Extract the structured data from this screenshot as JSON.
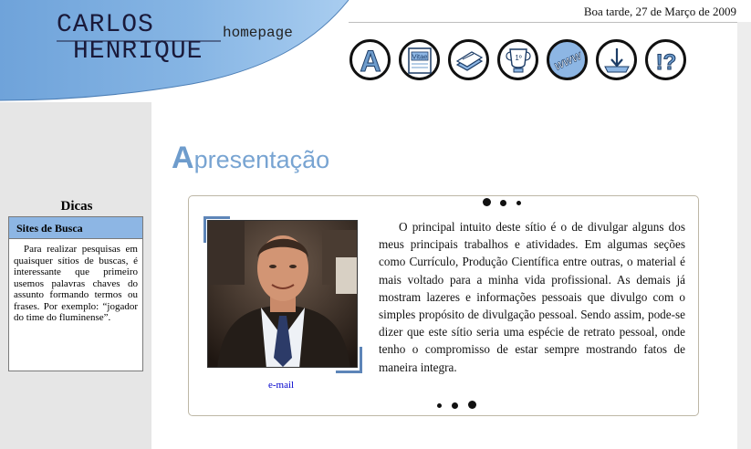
{
  "header": {
    "name_line1": "CARLOS",
    "name_line2": "HENRIQUE",
    "subtitle": "homepage",
    "date_text": "Boa tarde, 27 de Março de 2009",
    "swoosh_color": "#7eaee0"
  },
  "nav": [
    {
      "icon": "letter-a-icon",
      "glyph": "A"
    },
    {
      "icon": "vitae-document-icon",
      "glyph": "Vitae"
    },
    {
      "icon": "papers-icon",
      "glyph": ""
    },
    {
      "icon": "trophy-cup-icon",
      "glyph": "1º"
    },
    {
      "icon": "www-globe-icon",
      "glyph": "WWW"
    },
    {
      "icon": "download-arrow-icon",
      "glyph": ""
    },
    {
      "icon": "exclamation-question-icon",
      "glyph": "!?"
    }
  ],
  "sidebar": {
    "title": "Dicas",
    "box_title": "Sites de Busca",
    "tip_text": "Para realizar pesquisas em quaisquer sítios de buscas, é interessante que primeiro usemos palavras chaves do assunto formando termos ou frases. Por exemplo: “jogador do time do fluminense”."
  },
  "main": {
    "heading_first_letter": "A",
    "heading_rest": "presentação",
    "email_label": "e-mail",
    "intro_text": "O principal intuito deste sítio é o de divulgar alguns dos meus principais trabalhos e atividades. Em algumas seções como Currículo, Produção Científica entre outras, o material é mais voltado para a minha vida profissional. As demais já mostram lazeres e informações pessoais que divulgo com o simples propósito de divulgação pessoal. Sendo assim, pode-se dizer que este sítio seria uma espécie de retrato pessoal, onde tenho o compromisso de estar sempre mostrando fatos de maneira integra."
  },
  "colors": {
    "accent_blue": "#78a4d2",
    "sidebar_gray": "#e6e6e6",
    "link_blue": "#0000cc"
  }
}
